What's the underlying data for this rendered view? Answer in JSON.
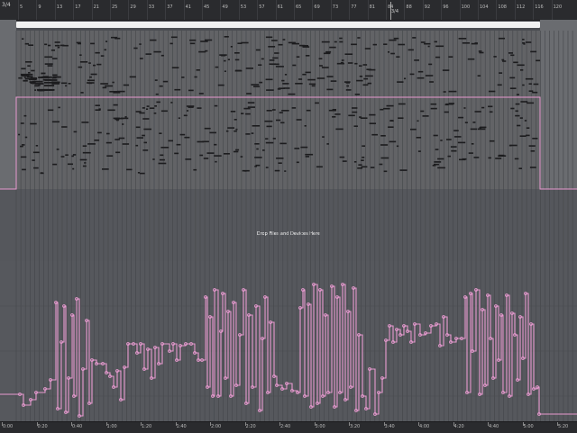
{
  "ruler": {
    "time_signature_start": "3/4",
    "time_signature_change": "3/4",
    "bars": [
      "5",
      "9",
      "13",
      "17",
      "21",
      "25",
      "29",
      "33",
      "37",
      "41",
      "45",
      "49",
      "53",
      "57",
      "61",
      "65",
      "69",
      "73",
      "77",
      "81",
      "84",
      "88",
      "92",
      "96",
      "100",
      "104",
      "108",
      "112",
      "116",
      "120"
    ]
  },
  "drop_zone": {
    "text": "Drop Files and Devices Here"
  },
  "timeline": {
    "labels": [
      "0:00",
      "0:20",
      "0:40",
      "1:00",
      "1:20",
      "1:40",
      "2:00",
      "2:20",
      "2:40",
      "3:00",
      "3:20",
      "3:40",
      "4:00",
      "4:20",
      "4:40",
      "5:00",
      "5:20"
    ]
  },
  "colors": {
    "ruler_bg": "#2a2b2e",
    "clip_bg": "#626366",
    "loop_brace": "#f1f1f1",
    "automation": "#e89ad0",
    "note": "#1c1c1e"
  },
  "automation": {
    "points": [
      [
        0,
        438
      ],
      [
        22,
        438
      ],
      [
        26,
        450
      ],
      [
        34,
        444
      ],
      [
        40,
        436
      ],
      [
        50,
        432
      ],
      [
        56,
        422
      ],
      [
        62,
        336
      ],
      [
        64,
        454
      ],
      [
        68,
        380
      ],
      [
        71,
        340
      ],
      [
        73,
        458
      ],
      [
        76,
        420
      ],
      [
        80,
        350
      ],
      [
        82,
        440
      ],
      [
        85,
        332
      ],
      [
        88,
        462
      ],
      [
        92,
        410
      ],
      [
        96,
        356
      ],
      [
        99,
        448
      ],
      [
        102,
        400
      ],
      [
        107,
        404
      ],
      [
        114,
        404
      ],
      [
        118,
        414
      ],
      [
        122,
        418
      ],
      [
        126,
        430
      ],
      [
        130,
        412
      ],
      [
        134,
        444
      ],
      [
        138,
        408
      ],
      [
        142,
        382
      ],
      [
        148,
        382
      ],
      [
        152,
        392
      ],
      [
        156,
        382
      ],
      [
        160,
        410
      ],
      [
        164,
        388
      ],
      [
        168,
        420
      ],
      [
        172,
        386
      ],
      [
        176,
        404
      ],
      [
        180,
        382
      ],
      [
        188,
        390
      ],
      [
        192,
        382
      ],
      [
        196,
        400
      ],
      [
        200,
        384
      ],
      [
        206,
        382
      ],
      [
        212,
        382
      ],
      [
        216,
        392
      ],
      [
        220,
        400
      ],
      [
        224,
        400
      ],
      [
        228,
        330
      ],
      [
        230,
        430
      ],
      [
        233,
        352
      ],
      [
        236,
        440
      ],
      [
        238,
        322
      ],
      [
        242,
        440
      ],
      [
        245,
        368
      ],
      [
        247,
        326
      ],
      [
        250,
        420
      ],
      [
        253,
        346
      ],
      [
        256,
        440
      ],
      [
        259,
        336
      ],
      [
        262,
        428
      ],
      [
        266,
        372
      ],
      [
        270,
        322
      ],
      [
        273,
        448
      ],
      [
        276,
        350
      ],
      [
        280,
        430
      ],
      [
        284,
        340
      ],
      [
        288,
        456
      ],
      [
        291,
        376
      ],
      [
        294,
        330
      ],
      [
        297,
        436
      ],
      [
        300,
        358
      ],
      [
        304,
        418
      ],
      [
        307,
        428
      ],
      [
        313,
        432
      ],
      [
        318,
        426
      ],
      [
        324,
        434
      ],
      [
        330,
        436
      ],
      [
        333,
        342
      ],
      [
        336,
        322
      ],
      [
        338,
        440
      ],
      [
        342,
        338
      ],
      [
        345,
        452
      ],
      [
        348,
        316
      ],
      [
        352,
        448
      ],
      [
        355,
        322
      ],
      [
        358,
        440
      ],
      [
        361,
        350
      ],
      [
        364,
        436
      ],
      [
        368,
        318
      ],
      [
        371,
        452
      ],
      [
        374,
        330
      ],
      [
        377,
        436
      ],
      [
        380,
        316
      ],
      [
        383,
        444
      ],
      [
        386,
        346
      ],
      [
        389,
        430
      ],
      [
        392,
        320
      ],
      [
        395,
        456
      ],
      [
        398,
        372
      ],
      [
        402,
        440
      ],
      [
        406,
        454
      ],
      [
        410,
        410
      ],
      [
        416,
        460
      ],
      [
        420,
        436
      ],
      [
        424,
        420
      ],
      [
        428,
        378
      ],
      [
        432,
        362
      ],
      [
        436,
        380
      ],
      [
        440,
        366
      ],
      [
        444,
        372
      ],
      [
        448,
        362
      ],
      [
        452,
        368
      ],
      [
        456,
        380
      ],
      [
        460,
        360
      ],
      [
        466,
        372
      ],
      [
        472,
        370
      ],
      [
        478,
        362
      ],
      [
        484,
        360
      ],
      [
        488,
        384
      ],
      [
        492,
        352
      ],
      [
        496,
        372
      ],
      [
        500,
        380
      ],
      [
        506,
        376
      ],
      [
        512,
        376
      ],
      [
        516,
        330
      ],
      [
        518,
        436
      ],
      [
        522,
        326
      ],
      [
        524,
        390
      ],
      [
        528,
        322
      ],
      [
        532,
        438
      ],
      [
        535,
        344
      ],
      [
        538,
        428
      ],
      [
        541,
        328
      ],
      [
        544,
        376
      ],
      [
        547,
        420
      ],
      [
        550,
        340
      ],
      [
        553,
        400
      ],
      [
        556,
        350
      ],
      [
        558,
        436
      ],
      [
        562,
        328
      ],
      [
        565,
        440
      ],
      [
        568,
        348
      ],
      [
        571,
        372
      ],
      [
        574,
        422
      ],
      [
        577,
        352
      ],
      [
        580,
        398
      ],
      [
        583,
        326
      ],
      [
        586,
        438
      ],
      [
        589,
        360
      ],
      [
        592,
        432
      ],
      [
        596,
        430
      ],
      [
        598,
        460
      ],
      [
        640,
        460
      ]
    ]
  }
}
